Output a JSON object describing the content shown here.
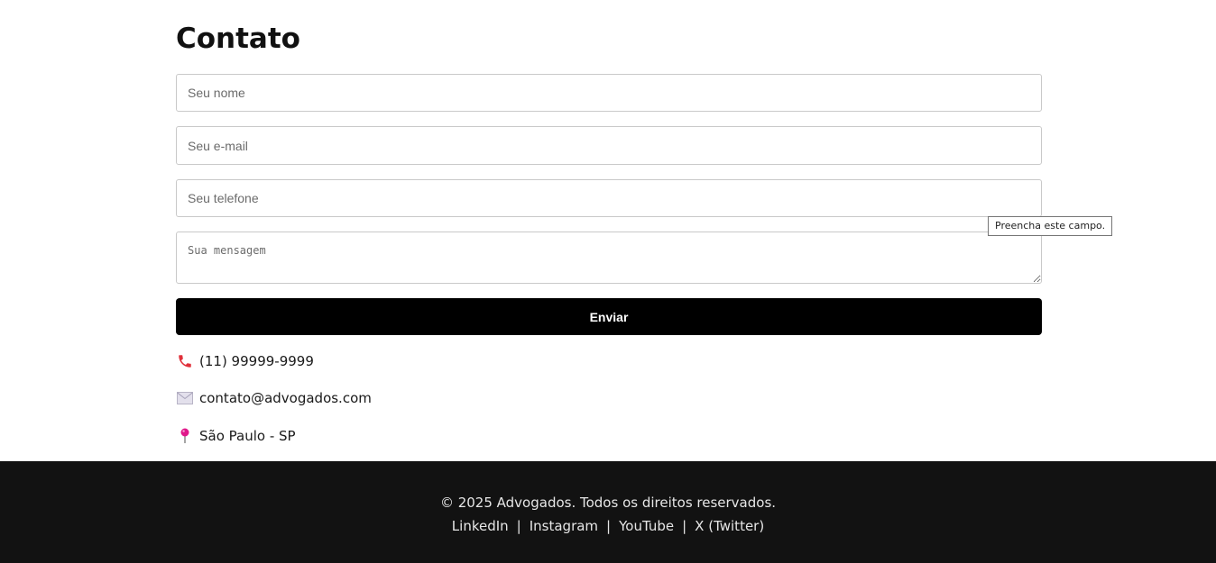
{
  "contact": {
    "title": "Contato",
    "form": {
      "name_placeholder": "Seu nome",
      "email_placeholder": "Seu e-mail",
      "phone_placeholder": "Seu telefone",
      "message_placeholder": "Sua mensagem",
      "submit_label": "Enviar"
    },
    "validation_tooltip": "Preencha este campo.",
    "info": {
      "phone": {
        "icon": "phone-icon",
        "text": "(11) 99999-9999"
      },
      "email": {
        "icon": "envelope-icon",
        "text": "contato@advogados.com"
      },
      "location": {
        "icon": "pin-icon",
        "text": "São Paulo - SP"
      }
    }
  },
  "footer": {
    "copyright": "© 2025 Advogados. Todos os direitos reservados.",
    "links": [
      "LinkedIn",
      "Instagram",
      "YouTube",
      "X (Twitter)"
    ],
    "separator": "|"
  },
  "colors": {
    "button_bg": "#000000",
    "footer_bg": "#121212",
    "phone_icon": "#e0303a",
    "pin_icon": "#e0188a"
  }
}
